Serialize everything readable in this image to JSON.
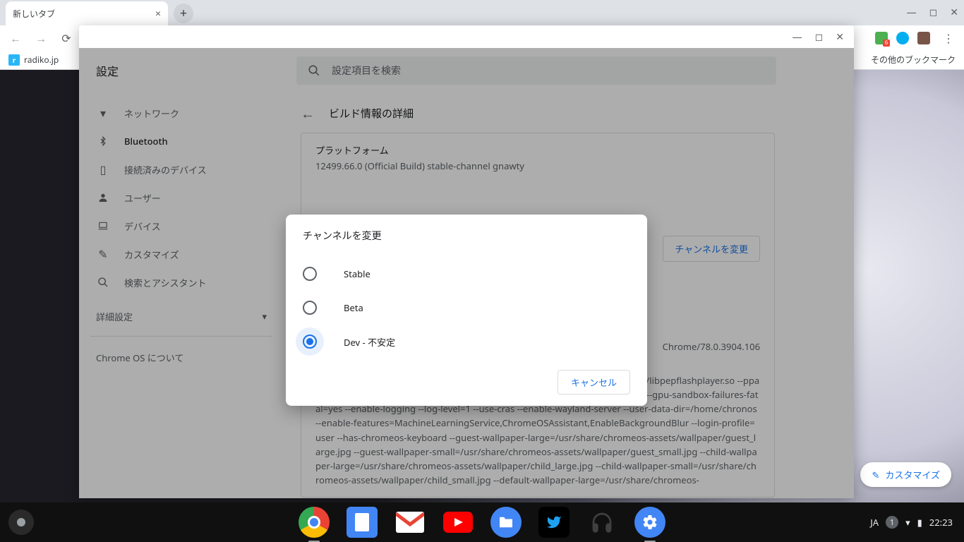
{
  "browser": {
    "tab_title": "新しいタブ",
    "newtab_plus": "+",
    "bookmarks": {
      "radiko": "radiko.jp",
      "other": "その他のブックマーク"
    }
  },
  "settings": {
    "title": "設定",
    "search_placeholder": "設定項目を検索",
    "sidebar": {
      "items": [
        {
          "label": "ネットワーク"
        },
        {
          "label": "Bluetooth"
        },
        {
          "label": "接続済みのデバイス"
        },
        {
          "label": "ユーザー"
        },
        {
          "label": "デバイス"
        },
        {
          "label": "カスタマイズ"
        },
        {
          "label": "検索とアシスタント"
        }
      ],
      "advanced": "詳細設定",
      "about": "Chrome OS について"
    },
    "content": {
      "header": "ビルド情報の詳細",
      "platform_label": "プラットフォーム",
      "platform_value": "12499.66.0 (Official Build) stable-channel gnawty",
      "change_channel_btn": "チャンネルを変更",
      "ua_suffix": "Chrome/78.0.3904.106",
      "cmdline": "/opt/google/chrome/chrome --ppapi-flash-path=/opt/google/chrome/pepper/libpepflashplayer.so --ppapi-flash-version=32.0.0.293 --use-gl=egl --enable-native-gpu-memory-buffers --gpu-sandbox-failures-fatal=yes --enable-logging --log-level=1 --use-cras --enable-wayland-server --user-data-dir=/home/chronos --enable-features=MachineLearningService,ChromeOSAssistant,EnableBackgroundBlur --login-profile=user --has-chromeos-keyboard --guest-wallpaper-large=/usr/share/chromeos-assets/wallpaper/guest_large.jpg --guest-wallpaper-small=/usr/share/chromeos-assets/wallpaper/guest_small.jpg --child-wallpaper-large=/usr/share/chromeos-assets/wallpaper/child_large.jpg --child-wallpaper-small=/usr/share/chromeos-assets/wallpaper/child_small.jpg --default-wallpaper-large=/usr/share/chromeos-"
    }
  },
  "modal": {
    "title": "チャンネルを変更",
    "options": [
      {
        "label": "Stable"
      },
      {
        "label": "Beta"
      },
      {
        "label": "Dev - 不安定"
      }
    ],
    "selected_index": 2,
    "cancel": "キャンセル"
  },
  "customize_pill": "カスタマイズ",
  "shelf": {
    "ime": "JA",
    "notif_count": "1",
    "clock": "22:23"
  }
}
